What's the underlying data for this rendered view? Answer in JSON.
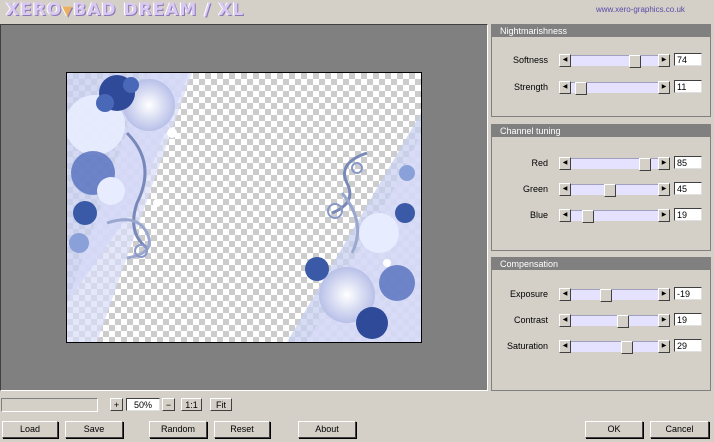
{
  "header": {
    "logo_text": "XERO",
    "logo_text2": "BAD DREAM / XL",
    "url": "www.xero-graphics.co.uk"
  },
  "panels": [
    {
      "title": "Nightmarishness",
      "sliders": [
        {
          "label": "Softness",
          "value": "74",
          "level": 0.74
        },
        {
          "label": "Strength",
          "value": "11",
          "level": 0.11
        }
      ]
    },
    {
      "title": "Channel tuning",
      "sliders": [
        {
          "label": "Red",
          "value": "85",
          "level": 0.85
        },
        {
          "label": "Green",
          "value": "45",
          "level": 0.45
        },
        {
          "label": "Blue",
          "value": "19",
          "level": 0.19
        }
      ]
    },
    {
      "title": "Compensation",
      "sliders": [
        {
          "label": "Exposure",
          "value": "-19",
          "level": 0.405
        },
        {
          "label": "Contrast",
          "value": "19",
          "level": 0.595
        },
        {
          "label": "Saturation",
          "value": "29",
          "level": 0.645
        }
      ]
    }
  ],
  "zoom": {
    "plus_label": "+",
    "value": "50%",
    "minus_label": "−",
    "one_to_one_label": "1:1",
    "fit_label": "Fit"
  },
  "buttons": {
    "load": "Load",
    "save": "Save",
    "random": "Random",
    "reset": "Reset",
    "about": "About",
    "ok": "OK",
    "cancel": "Cancel"
  },
  "colors": {
    "panel_title_bg": "#808080",
    "slider_track": "#e4e2ff",
    "artwork_blue": "#3a5aa8",
    "artwork_light": "#e8ecff"
  }
}
